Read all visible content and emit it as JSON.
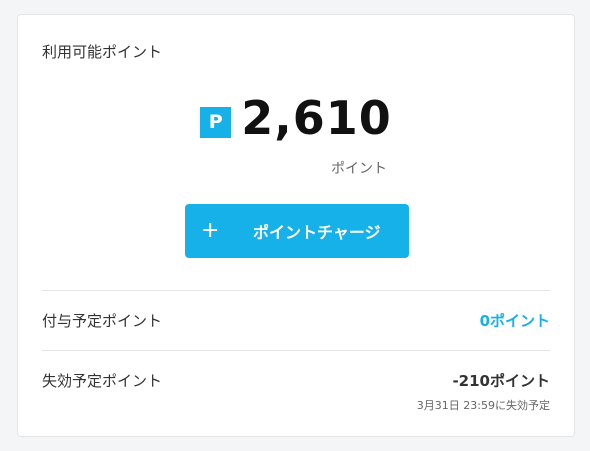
{
  "available": {
    "title": "利用可能ポイント",
    "badge": "P",
    "value": "2,610",
    "unit": "ポイント"
  },
  "charge_button": {
    "icon": "plus-icon",
    "label": "ポイントチャージ"
  },
  "pending": {
    "label": "付与予定ポイント",
    "value": "0ポイント"
  },
  "expiring": {
    "label": "失効予定ポイント",
    "value": "-210ポイント",
    "note": "3月31日 23:59に失効予定"
  },
  "colors": {
    "accent": "#16b1e8",
    "page_bg": "#f4f5f7"
  }
}
